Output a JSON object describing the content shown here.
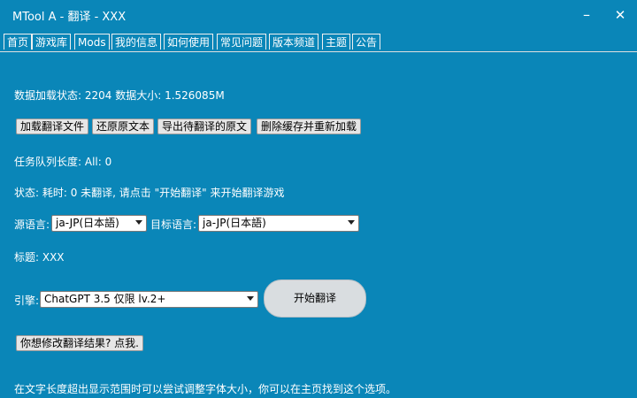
{
  "window": {
    "title": "MTool A - 翻译 - XXX",
    "minimize_symbol": "–",
    "close_symbol": "✕"
  },
  "tabs": [
    {
      "label": "首页"
    },
    {
      "label": "游戏库"
    },
    {
      "label": "Mods"
    },
    {
      "label": "我的信息"
    },
    {
      "label": "如何使用"
    },
    {
      "label": "常见问题"
    },
    {
      "label": "版本频道"
    },
    {
      "label": "主题"
    },
    {
      "label": "公告"
    }
  ],
  "status": {
    "data_load": "数据加载状态: 2204 数据大小: 1.526085M",
    "queue": "任务队列长度: All: 0",
    "state": "状态: 耗时: 0 未翻译, 请点击 \"开始翻译\" 来开始翻译游戏",
    "title": "标题: XXX"
  },
  "actions": {
    "load_translation": "加载翻译文件",
    "restore_original": "还原原文本",
    "export_untranslated": "导出待翻译的原文",
    "clear_cache_reload": "删除缓存并重新加载"
  },
  "language": {
    "source_label": "源语言:",
    "source_value": "ja-JP(日本語)",
    "target_label": "目标语言:",
    "target_value": "ja-JP(日本語)"
  },
  "engine": {
    "label": "引擎:",
    "value": "ChatGPT 3.5 仅限 lv.2+",
    "start_button": "开始翻译"
  },
  "modify_button": "你想修改翻译结果? 点我.",
  "footer_hint": "在文字长度超出显示范围时可以尝试调整字体大小，你可以在主页找到这个选项。",
  "colors": {
    "background": "#0a86b8",
    "button": "#e6e6e6",
    "start_button": "#d9dde0"
  }
}
